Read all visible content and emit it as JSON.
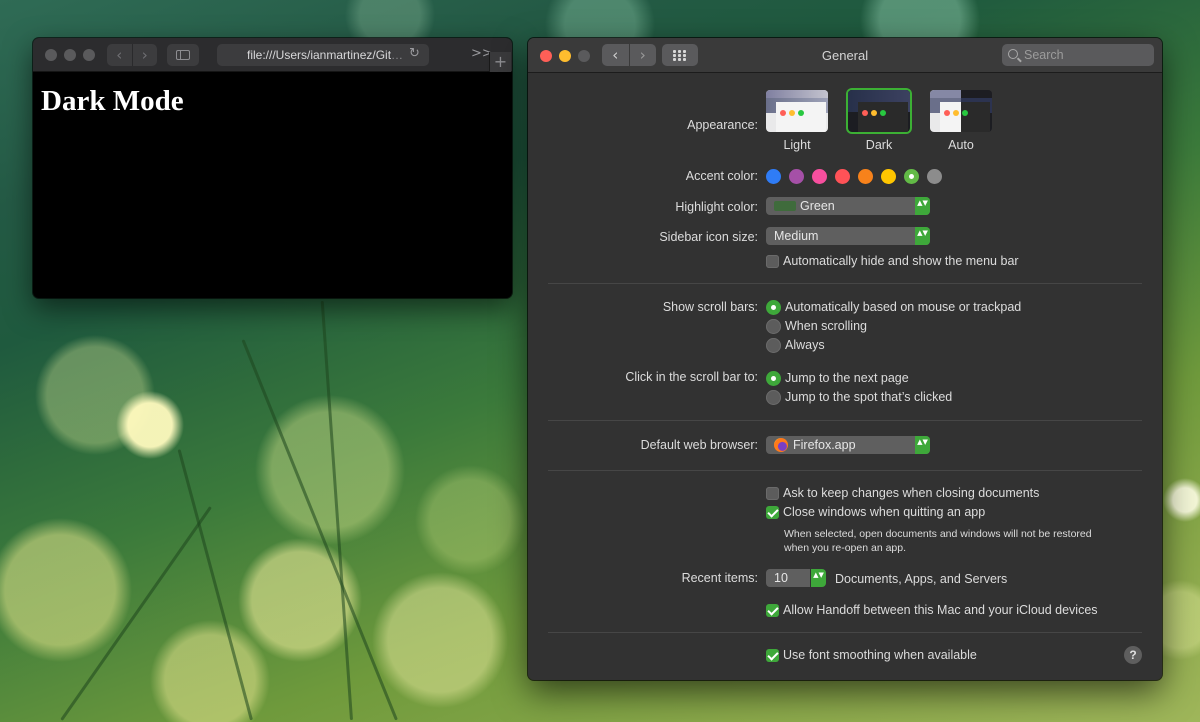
{
  "browser": {
    "address": "file:///Users/ianmartinez/Git",
    "address_fade": "…",
    "more_glyph": ">>",
    "new_tab_glyph": "+",
    "heading": "Dark Mode",
    "back_glyph": "‹",
    "forward_glyph": "›",
    "reload_glyph": "↻"
  },
  "prefs": {
    "title": "General",
    "search_placeholder": "Search",
    "back_glyph": "‹",
    "forward_glyph": "›",
    "appearance": {
      "label": "Appearance:",
      "options": [
        "Light",
        "Dark",
        "Auto"
      ],
      "selected": "Dark"
    },
    "accent": {
      "label": "Accent color:",
      "colors": [
        "#2f7cf6",
        "#a550a7",
        "#f74f9e",
        "#ff5257",
        "#f7821b",
        "#ffc600",
        "#62ba46",
        "#8c8c8c"
      ],
      "selected_index": 6
    },
    "highlight": {
      "label": "Highlight color:",
      "value": "Green",
      "swatch": "#3f6b3c"
    },
    "sidebar_icon": {
      "label": "Sidebar icon size:",
      "value": "Medium"
    },
    "auto_hide_menu": {
      "label": "Automatically hide and show the menu bar",
      "checked": false
    },
    "scroll_bars": {
      "label": "Show scroll bars:",
      "options": [
        "Automatically based on mouse or trackpad",
        "When scrolling",
        "Always"
      ],
      "selected_index": 0
    },
    "click_scroll": {
      "label": "Click in the scroll bar to:",
      "options": [
        "Jump to the next page",
        "Jump to the spot that’s clicked"
      ],
      "selected_index": 0
    },
    "browser_default": {
      "label": "Default web browser:",
      "value": "Firefox.app"
    },
    "ask_keep_changes": {
      "label": "Ask to keep changes when closing documents",
      "checked": false
    },
    "close_windows": {
      "label": "Close windows when quitting an app",
      "checked": true
    },
    "close_windows_note": [
      "When selected, open documents and windows will not be restored",
      "when you re-open an app."
    ],
    "recent_items": {
      "label": "Recent items:",
      "value": "10",
      "suffix": "Documents, Apps, and Servers"
    },
    "handoff": {
      "label": "Allow Handoff between this Mac and your iCloud devices",
      "checked": true
    },
    "font_smoothing": {
      "label": "Use font smoothing when available",
      "checked": true
    },
    "help_glyph": "?",
    "stepper_glyph": "▲▼",
    "colors": {
      "accent_green": "#3ea83a",
      "close": "#ff5f57",
      "minimize": "#ffbd2e",
      "zoom_disabled": "#5a5a5c"
    }
  }
}
